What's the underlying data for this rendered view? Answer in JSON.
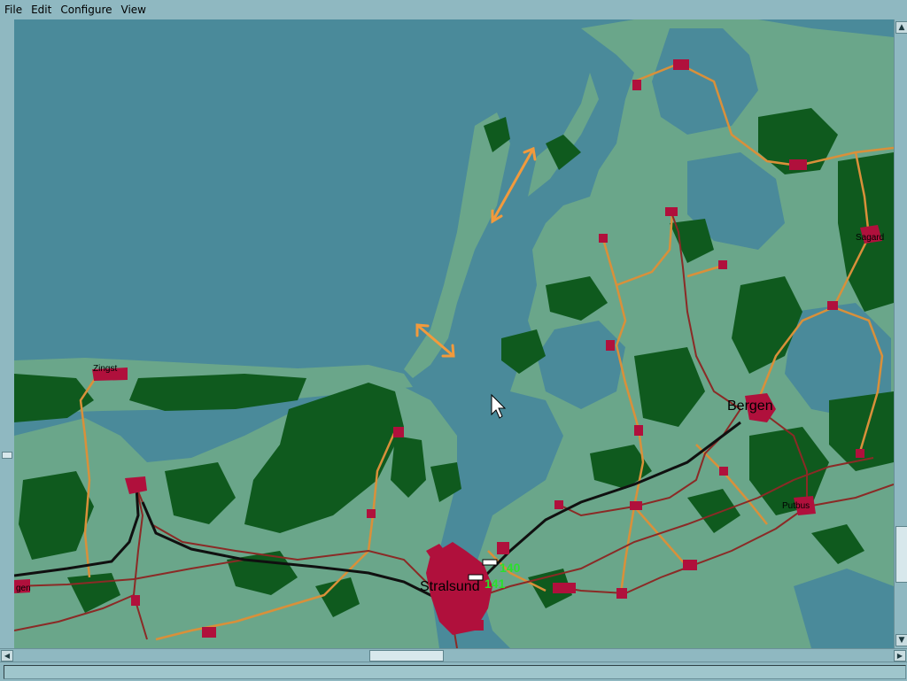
{
  "menubar": {
    "file": "File",
    "edit": "Edit",
    "configure": "Configure",
    "view": "View"
  },
  "map": {
    "cities": {
      "zingst": "Zingst",
      "sagard": "Sagard",
      "bergen": "Bergen",
      "putbus": "Putbus",
      "stralsund": "Stralsund",
      "gen": "gen"
    },
    "train_numbers": {
      "train_1": "140",
      "train_2": "141"
    }
  },
  "colors": {
    "water": "#4a8a9a",
    "land": "#6aa68a",
    "forest": "#0f5a1e",
    "city": "#b0103c",
    "road": "#d9903a",
    "rail": "#8b2a26",
    "main_rail": "#101010",
    "arrow": "#f29a3c",
    "train_label": "#2be02b"
  },
  "status": {
    "text": ""
  }
}
